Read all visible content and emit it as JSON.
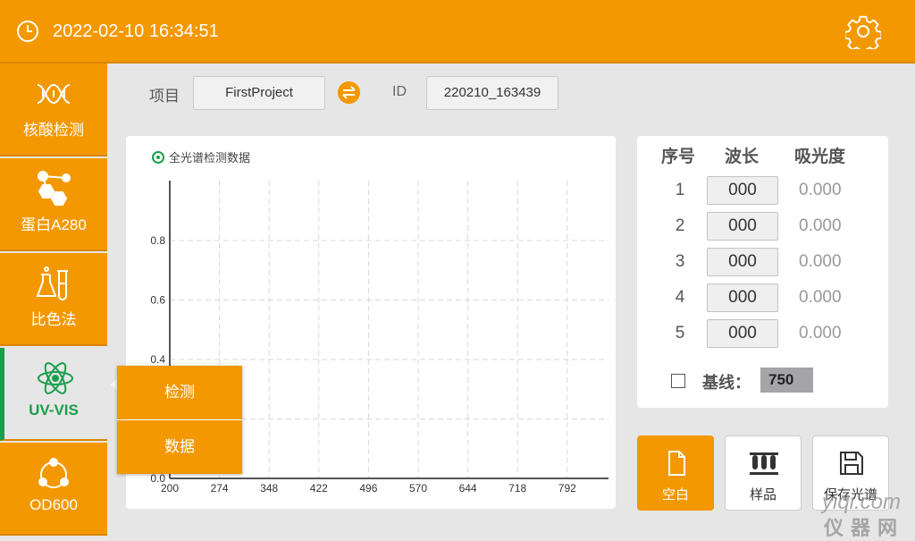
{
  "header": {
    "datetime": "2022-02-10 16:34:51",
    "clock_icon": "clock-icon",
    "settings_icon": "gear-icon"
  },
  "sidebar": {
    "items": [
      {
        "label": "核酸检测",
        "icon": "dna-icon"
      },
      {
        "label": "蛋白A280",
        "icon": "molecule-icon"
      },
      {
        "label": "比色法",
        "icon": "flask-icon"
      },
      {
        "label": "UV-VIS",
        "icon": "atom-icon",
        "active": true
      },
      {
        "label": "OD600",
        "icon": "cycle-icon"
      }
    ]
  },
  "project": {
    "label": "项目",
    "name": "FirstProject",
    "id_label": "ID",
    "id_value": "220210_163439"
  },
  "chart_legend": "全光谱检测数据",
  "chart_data": {
    "type": "line",
    "x_ticks": [
      "200",
      "274",
      "348",
      "422",
      "496",
      "570",
      "644",
      "718",
      "792"
    ],
    "y_ticks": [
      "0.0",
      "0.4",
      "0.6",
      "0.8"
    ],
    "ylim": [
      0.0,
      0.8
    ],
    "series": [
      {
        "name": "全光谱检测数据",
        "values": []
      }
    ],
    "grid": true
  },
  "popup": {
    "items": [
      "检测",
      "数据"
    ]
  },
  "table": {
    "headers": [
      "序号",
      "波长",
      "吸光度"
    ],
    "rows": [
      {
        "index": "1",
        "wavelength": "000",
        "absorbance": "0.000"
      },
      {
        "index": "2",
        "wavelength": "000",
        "absorbance": "0.000"
      },
      {
        "index": "3",
        "wavelength": "000",
        "absorbance": "0.000"
      },
      {
        "index": "4",
        "wavelength": "000",
        "absorbance": "0.000"
      },
      {
        "index": "5",
        "wavelength": "000",
        "absorbance": "0.000"
      }
    ],
    "baseline_label": "基线：",
    "baseline_value": "750"
  },
  "buttons": [
    {
      "label": "空白",
      "icon": "document-icon"
    },
    {
      "label": "样品",
      "icon": "test-tubes-icon"
    },
    {
      "label": "保存光谱",
      "icon": "save-icon"
    }
  ],
  "watermark": {
    "line1": "yiqi.com",
    "line2": "仪器网"
  },
  "colors": {
    "accent": "#f39800",
    "active": "#1a9e4b"
  }
}
